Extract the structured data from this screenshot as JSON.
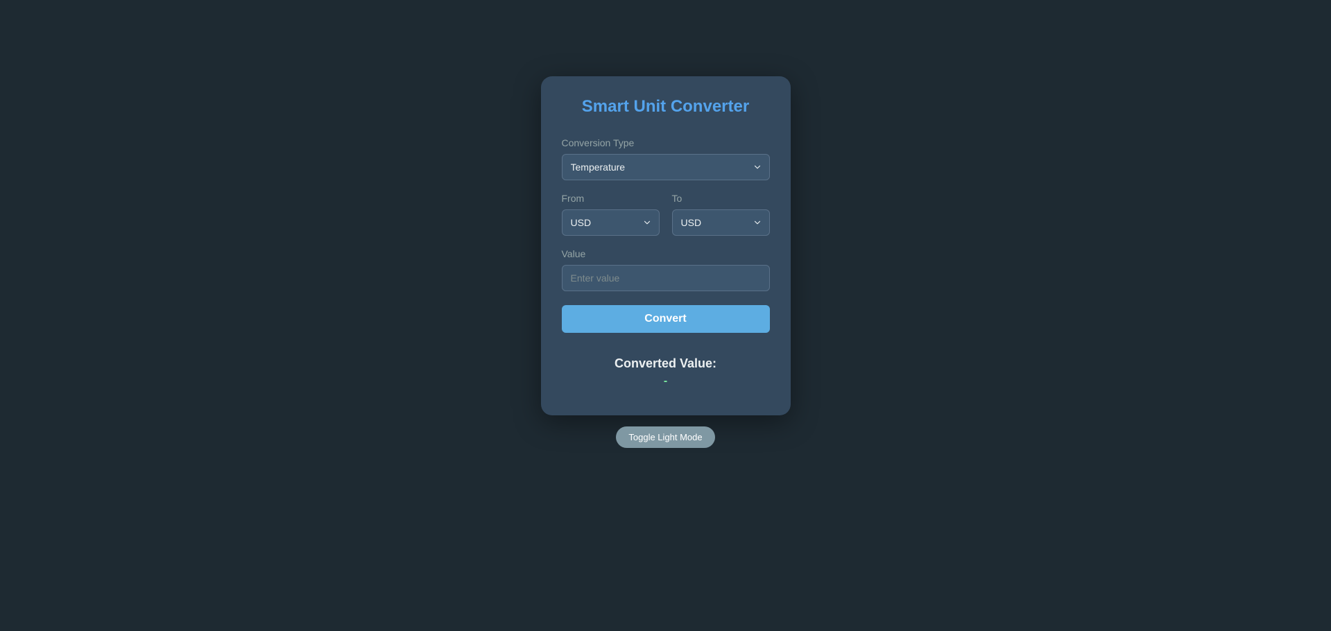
{
  "title": "Smart Unit Converter",
  "labels": {
    "conversionType": "Conversion Type",
    "from": "From",
    "to": "To",
    "value": "Value"
  },
  "selects": {
    "conversionTypeValue": "Temperature",
    "fromValue": "USD",
    "toValue": "USD"
  },
  "input": {
    "placeholder": "Enter value",
    "value": ""
  },
  "buttons": {
    "convert": "Convert",
    "toggle": "Toggle Light Mode"
  },
  "result": {
    "label": "Converted Value:",
    "value": "-"
  }
}
